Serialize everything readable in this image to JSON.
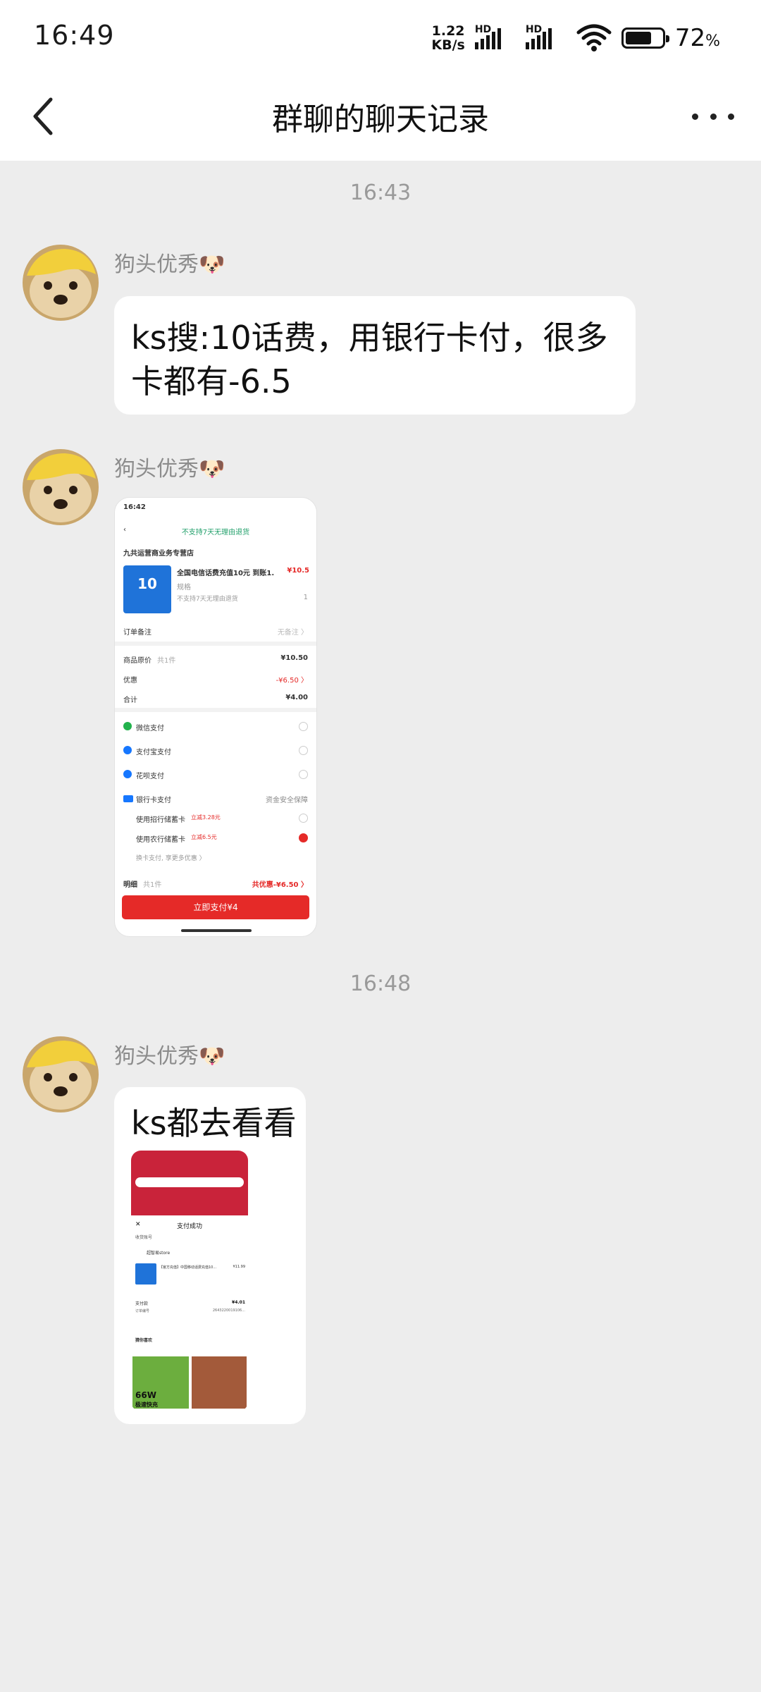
{
  "status_bar": {
    "time": "16:49",
    "net_speed_value": "1.22",
    "net_speed_unit": "KB/s",
    "sim1": "HD",
    "sim2": "HD",
    "battery_percent": "72",
    "battery_unit": "%",
    "battery_level": 0.72
  },
  "header": {
    "title": "群聊的聊天记录",
    "back_icon": "chevron-left-icon",
    "more_icon": "more-horizontal-icon"
  },
  "messages": [
    {
      "time": "16:43",
      "sender": "狗头优秀🐶",
      "text": "ks搜:10话费，用银行卡付，很多卡都有-6.5"
    },
    {
      "sender": "狗头优秀🐶",
      "image": {
        "status_time": "16:42",
        "notice": "不支持7天无理由退货",
        "store": "九共运营商业务专营店",
        "product_title": "全国电信话费充值10元  到账1...",
        "product_price": "¥10.5",
        "product_badge": "10",
        "product_spec": "规格",
        "product_note": "不支持7天无理由退货",
        "quantity": "1",
        "order_note_label": "订单备注",
        "order_note_value": "无备注 〉",
        "price_rows": [
          {
            "label": "商品原价",
            "sub": "共1件",
            "value": "¥10.50"
          },
          {
            "label": "优惠",
            "sub": "",
            "value": "-¥6.50 〉"
          },
          {
            "label": "合计",
            "sub": "",
            "value": "¥4.00"
          }
        ],
        "pay_methods": [
          "微信支付",
          "支付宝支付",
          "花呗支付"
        ],
        "bank_label": "银行卡支付",
        "bank_safe": "资金安全保障",
        "bank_cards": [
          {
            "label": "使用招行储蓄卡",
            "tag": "立减3.28元"
          },
          {
            "label": "使用农行储蓄卡",
            "tag": "立减6.5元"
          }
        ],
        "bank_more": "换卡支付, 享更多优惠 〉",
        "detail_label": "明细",
        "detail_count": "共1件",
        "detail_discount": "共优惠-¥6.50 〉",
        "pay_button": "立即支付¥4"
      }
    },
    {
      "time": "16:48",
      "sender": "狗头优秀🐶",
      "text": "ks都去看看",
      "image": {
        "title": "支付成功",
        "row1": "收货账号",
        "shop": "超智易store",
        "product": "【官方充值】中国移动话费充值10...",
        "product_price": "¥11.99",
        "pay_label": "支付款",
        "pay_value": "¥4.01",
        "order_label": "订单编号",
        "order_value": "2643220019106...",
        "recommend": "猜你喜欢",
        "promo": "66W",
        "promo2": "极速快充"
      }
    }
  ],
  "colors": {
    "background": "#ededed",
    "bubble": "#ffffff",
    "accent_red": "#e52a28",
    "sender_gray": "#8c8c8c"
  }
}
